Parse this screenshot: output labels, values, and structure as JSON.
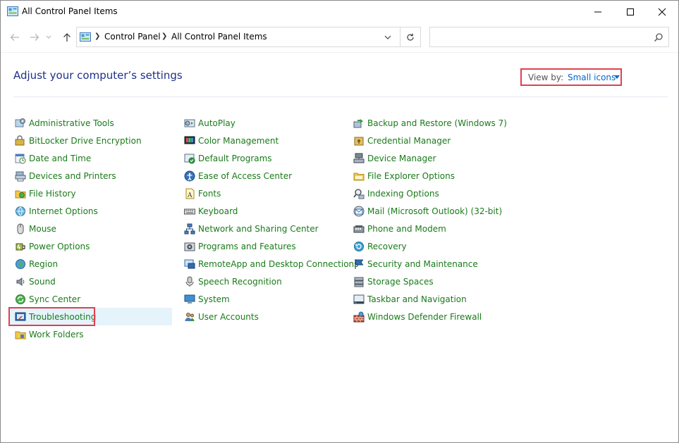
{
  "window": {
    "title": "All Control Panel Items",
    "controls": [
      "minimize",
      "maximize",
      "close"
    ]
  },
  "nav": {
    "breadcrumbs": [
      "Control Panel",
      "All Control Panel Items"
    ],
    "search_placeholder": ""
  },
  "content": {
    "heading": "Adjust your computer’s settings",
    "view_by": {
      "label": "View by:",
      "value": "Small icons"
    },
    "columns": [
      [
        {
          "label": "Administrative Tools",
          "icon": "administrative-tools-icon"
        },
        {
          "label": "BitLocker Drive Encryption",
          "icon": "bitlocker-icon"
        },
        {
          "label": "Date and Time",
          "icon": "date-time-icon"
        },
        {
          "label": "Devices and Printers",
          "icon": "devices-printers-icon"
        },
        {
          "label": "File History",
          "icon": "file-history-icon"
        },
        {
          "label": "Internet Options",
          "icon": "internet-options-icon"
        },
        {
          "label": "Mouse",
          "icon": "mouse-icon"
        },
        {
          "label": "Power Options",
          "icon": "power-options-icon"
        },
        {
          "label": "Region",
          "icon": "region-icon"
        },
        {
          "label": "Sound",
          "icon": "sound-icon"
        },
        {
          "label": "Sync Center",
          "icon": "sync-center-icon"
        },
        {
          "label": "Troubleshooting",
          "icon": "troubleshooting-icon",
          "selected": true
        },
        {
          "label": "Work Folders",
          "icon": "work-folders-icon"
        }
      ],
      [
        {
          "label": "AutoPlay",
          "icon": "autoplay-icon"
        },
        {
          "label": "Color Management",
          "icon": "color-management-icon"
        },
        {
          "label": "Default Programs",
          "icon": "default-programs-icon"
        },
        {
          "label": "Ease of Access Center",
          "icon": "ease-of-access-icon"
        },
        {
          "label": "Fonts",
          "icon": "fonts-icon"
        },
        {
          "label": "Keyboard",
          "icon": "keyboard-icon"
        },
        {
          "label": "Network and Sharing Center",
          "icon": "network-sharing-icon"
        },
        {
          "label": "Programs and Features",
          "icon": "programs-features-icon"
        },
        {
          "label": "RemoteApp and Desktop Connections",
          "icon": "remoteapp-icon"
        },
        {
          "label": "Speech Recognition",
          "icon": "speech-recognition-icon"
        },
        {
          "label": "System",
          "icon": "system-icon"
        },
        {
          "label": "User Accounts",
          "icon": "user-accounts-icon"
        }
      ],
      [
        {
          "label": "Backup and Restore (Windows 7)",
          "icon": "backup-restore-icon"
        },
        {
          "label": "Credential Manager",
          "icon": "credential-manager-icon"
        },
        {
          "label": "Device Manager",
          "icon": "device-manager-icon"
        },
        {
          "label": "File Explorer Options",
          "icon": "file-explorer-options-icon"
        },
        {
          "label": "Indexing Options",
          "icon": "indexing-options-icon"
        },
        {
          "label": "Mail (Microsoft Outlook) (32-bit)",
          "icon": "mail-icon"
        },
        {
          "label": "Phone and Modem",
          "icon": "phone-modem-icon"
        },
        {
          "label": "Recovery",
          "icon": "recovery-icon"
        },
        {
          "label": "Security and Maintenance",
          "icon": "security-maintenance-icon"
        },
        {
          "label": "Storage Spaces",
          "icon": "storage-spaces-icon"
        },
        {
          "label": "Taskbar and Navigation",
          "icon": "taskbar-navigation-icon"
        },
        {
          "label": "Windows Defender Firewall",
          "icon": "firewall-icon"
        }
      ]
    ]
  },
  "colors": {
    "link": "#1a7a1a",
    "heading": "#1e3287",
    "view_by_value": "#0066cc",
    "highlight_box": "#e0404e",
    "selected_bg": "#e5f3fb"
  }
}
